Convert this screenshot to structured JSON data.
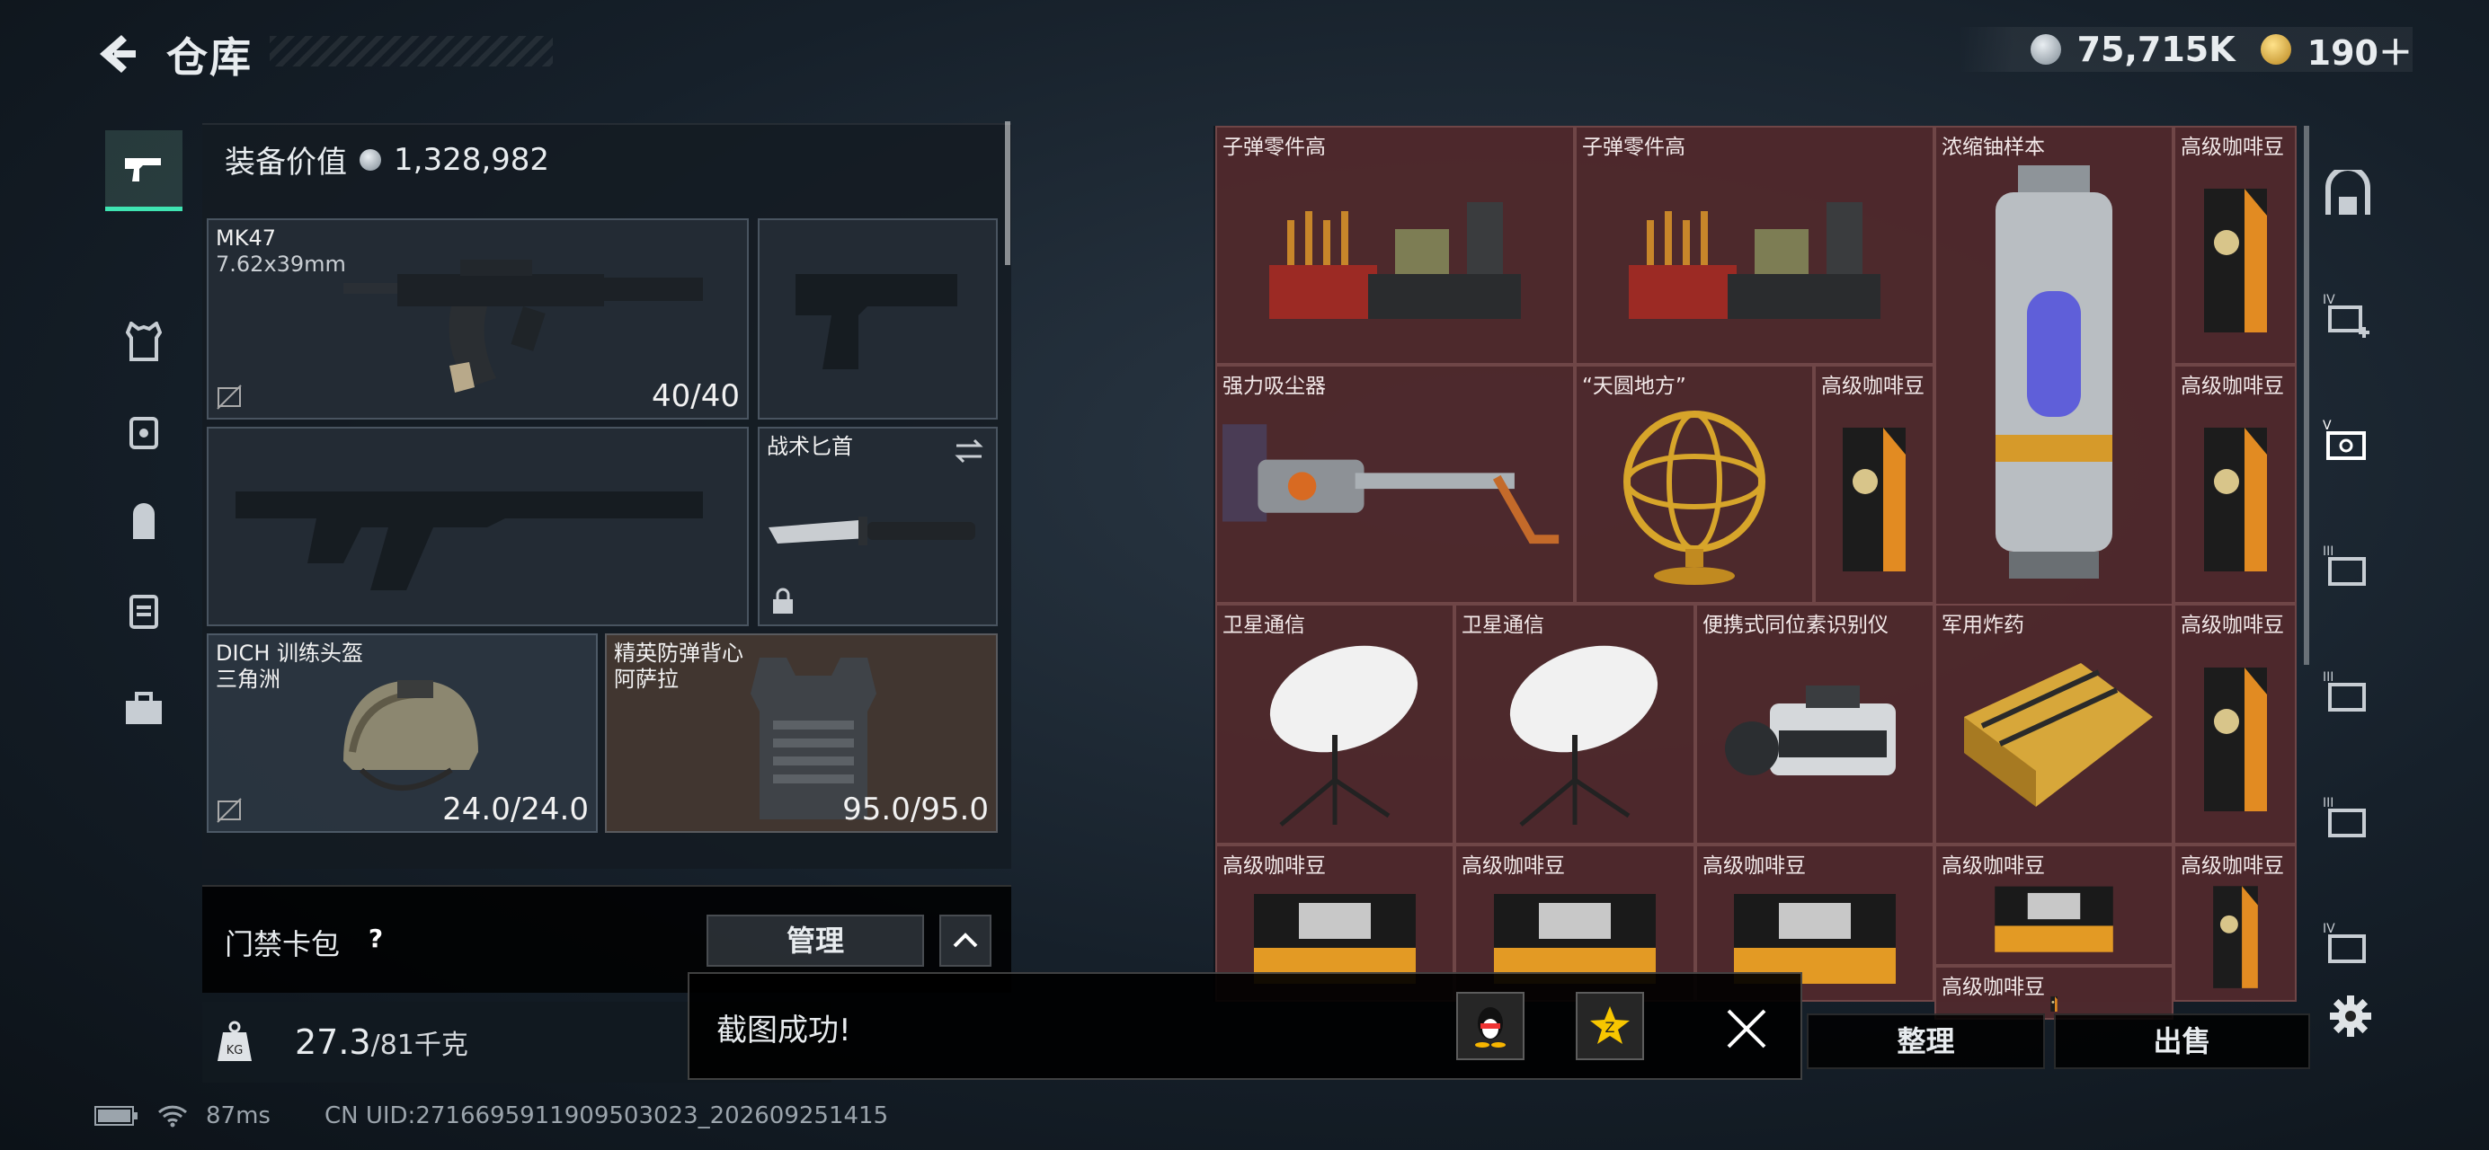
{
  "header": {
    "title": "仓库",
    "currency": [
      {
        "icon": "silver-coin-icon",
        "value": "75,715K"
      },
      {
        "icon": "gold-coin-icon",
        "value": "190＋"
      }
    ]
  },
  "equipment": {
    "value_label": "装备价值",
    "value": "1,328,982",
    "slots": {
      "primary_weapon": {
        "name": "MK47",
        "ammo": "7.62x39mm",
        "value": "40/40"
      },
      "melee": {
        "name": "战术匕首"
      },
      "helmet": {
        "name": "DICH 训练头盔",
        "sub": "三角洲",
        "value": "24.0/24.0"
      },
      "armor": {
        "name": "精英防弹背心",
        "sub": "阿萨拉",
        "value": "95.0/95.0"
      }
    },
    "keycard_label": "门禁卡包",
    "help": "?",
    "manage_label": "管理",
    "weight_current": "27.3",
    "weight_max": "/81千克"
  },
  "stash": {
    "items": [
      {
        "name": "子弹零件高",
        "art": "ammo-parts"
      },
      {
        "name": "子弹零件高",
        "art": "ammo-parts"
      },
      {
        "name": "浓缩铀样本",
        "art": "uranium"
      },
      {
        "name": "高级咖啡豆",
        "art": "coffee"
      },
      {
        "name": "强力吸尘器",
        "art": "vacuum"
      },
      {
        "name": "“天圆地方”",
        "art": "armillary"
      },
      {
        "name": "高级咖啡豆",
        "art": "coffee"
      },
      {
        "name": "高级咖啡豆",
        "art": "coffee"
      },
      {
        "name": "卫星通信",
        "art": "satellite"
      },
      {
        "name": "卫星通信",
        "art": "satellite"
      },
      {
        "name": "便携式同位素识别仪",
        "art": "isotope"
      },
      {
        "name": "军用炸药",
        "art": "explosive"
      },
      {
        "name": "高级咖啡豆",
        "art": "coffee"
      },
      {
        "name": "高级咖啡豆",
        "art": "coffee-tin"
      },
      {
        "name": "高级咖啡豆",
        "art": "coffee-tin"
      },
      {
        "name": "高级咖啡豆",
        "art": "coffee-tin"
      },
      {
        "name": "高级咖啡豆",
        "art": "coffee-tin"
      },
      {
        "name": "高级咖啡豆",
        "art": "coffee"
      },
      {
        "name": "高级咖啡豆",
        "art": "coffee"
      }
    ],
    "sort_label": "整理",
    "sell_label": "出售"
  },
  "toast": {
    "message": "截图成功!"
  },
  "status": {
    "ping": "87ms",
    "uid": "CN UID:2716695911909503023_202609251415"
  },
  "colors": {
    "accent": "#3fe4b2",
    "stash_cell": "#522a2e"
  }
}
